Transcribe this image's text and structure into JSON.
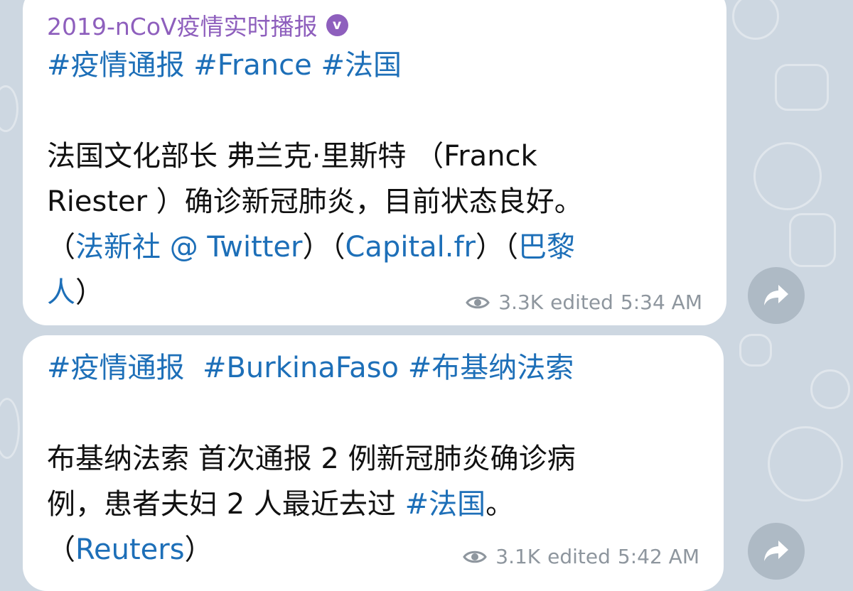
{
  "channel": {
    "name": "2019-nCoV疫情实时播报",
    "verified_glyph": "v"
  },
  "messages": [
    {
      "tags_line": [
        "#疫情通报",
        "#France",
        "#法国"
      ],
      "body": {
        "l1": "法国文化部长 弗兰克·里斯特 （Franck",
        "l2": "Riester ）确诊新冠肺炎，目前状态良好。",
        "l3_open1": "（",
        "l3_link1": "法新社 @ Twitter",
        "l3_close1_open2": "）（",
        "l3_link2": "Capital.fr",
        "l3_close2_open3": "）（",
        "l3_link3a": "巴黎",
        "l4_link3b": "人",
        "l4_close3": "）"
      },
      "views": "3.3K",
      "edited": "edited",
      "time": "5:34 AM"
    },
    {
      "tags_line": [
        "#疫情通报",
        "#BurkinaFaso",
        "#布基纳法索"
      ],
      "body": {
        "l1": "布基纳法索 首次通报 2 例新冠肺炎确诊病",
        "l2_text": "例，患者夫妇 2 人最近去过 ",
        "l2_tag": "#法国",
        "l2_end": "。",
        "l3_open": "（",
        "l3_link": "Reuters",
        "l3_close": "）"
      },
      "views": "3.1K",
      "edited": "edited",
      "time": "5:42 AM"
    }
  ],
  "icons": {
    "views": "eye-icon",
    "share": "share-arrow-icon",
    "verified": "verified-badge-icon"
  },
  "colors": {
    "link": "#1d6fb8",
    "channel_name": "#8e5fbd",
    "meta": "#8e969e",
    "wallpaper": "#cdd7e1"
  }
}
